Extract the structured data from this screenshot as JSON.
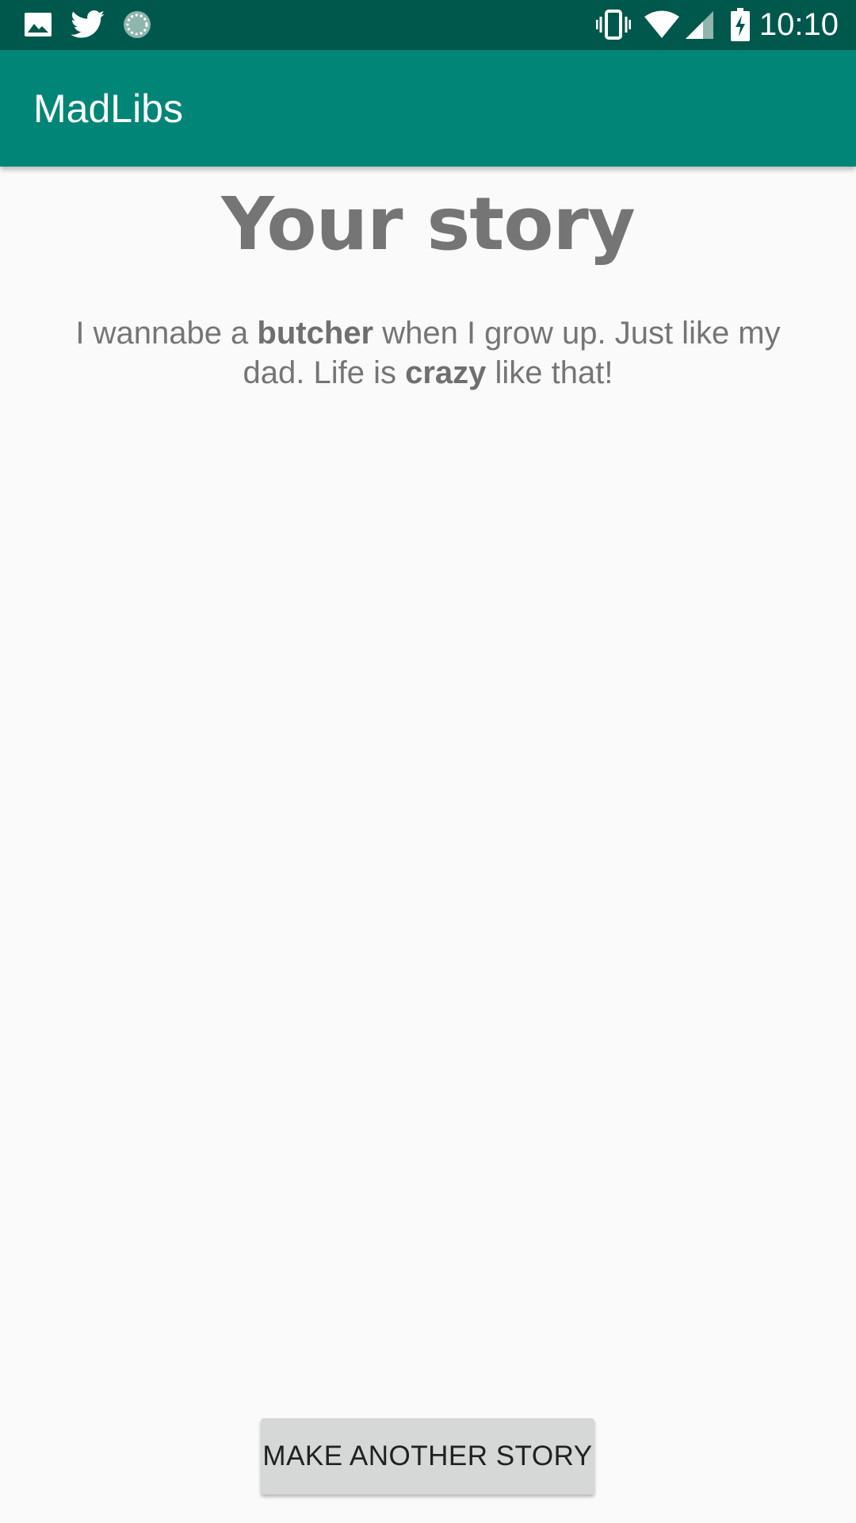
{
  "status_bar": {
    "time": "10:10",
    "left_icons": [
      "image-icon",
      "twitter-icon",
      "sync-progress-icon"
    ],
    "right_icons": [
      "vibrate-icon",
      "wifi-icon",
      "cell-signal-icon",
      "battery-charging-icon"
    ]
  },
  "app_bar": {
    "title": "MadLibs",
    "color": "#008577"
  },
  "main": {
    "heading": "Your story",
    "story": {
      "part1": "I wannabe a ",
      "word1": "butcher",
      "part2": " when I grow up. Just like my dad. Life is ",
      "word2": "crazy",
      "part3": " like that!"
    }
  },
  "actions": {
    "make_another_label": "MAKE ANOTHER STORY"
  },
  "colors": {
    "status_bar": "#00574b",
    "app_bar": "#008577",
    "background": "#fafafa",
    "text": "#757575"
  }
}
